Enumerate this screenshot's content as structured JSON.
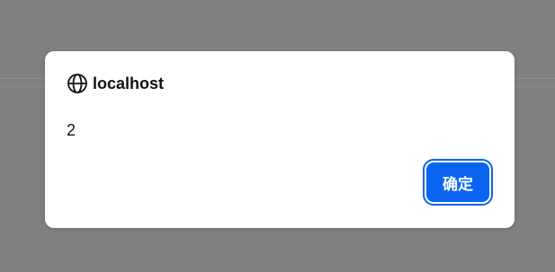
{
  "dialog": {
    "origin": "localhost",
    "message": "2",
    "ok_label": "确定",
    "accent_color": "#0a64f0"
  },
  "icons": {
    "origin_icon": "globe-icon"
  }
}
